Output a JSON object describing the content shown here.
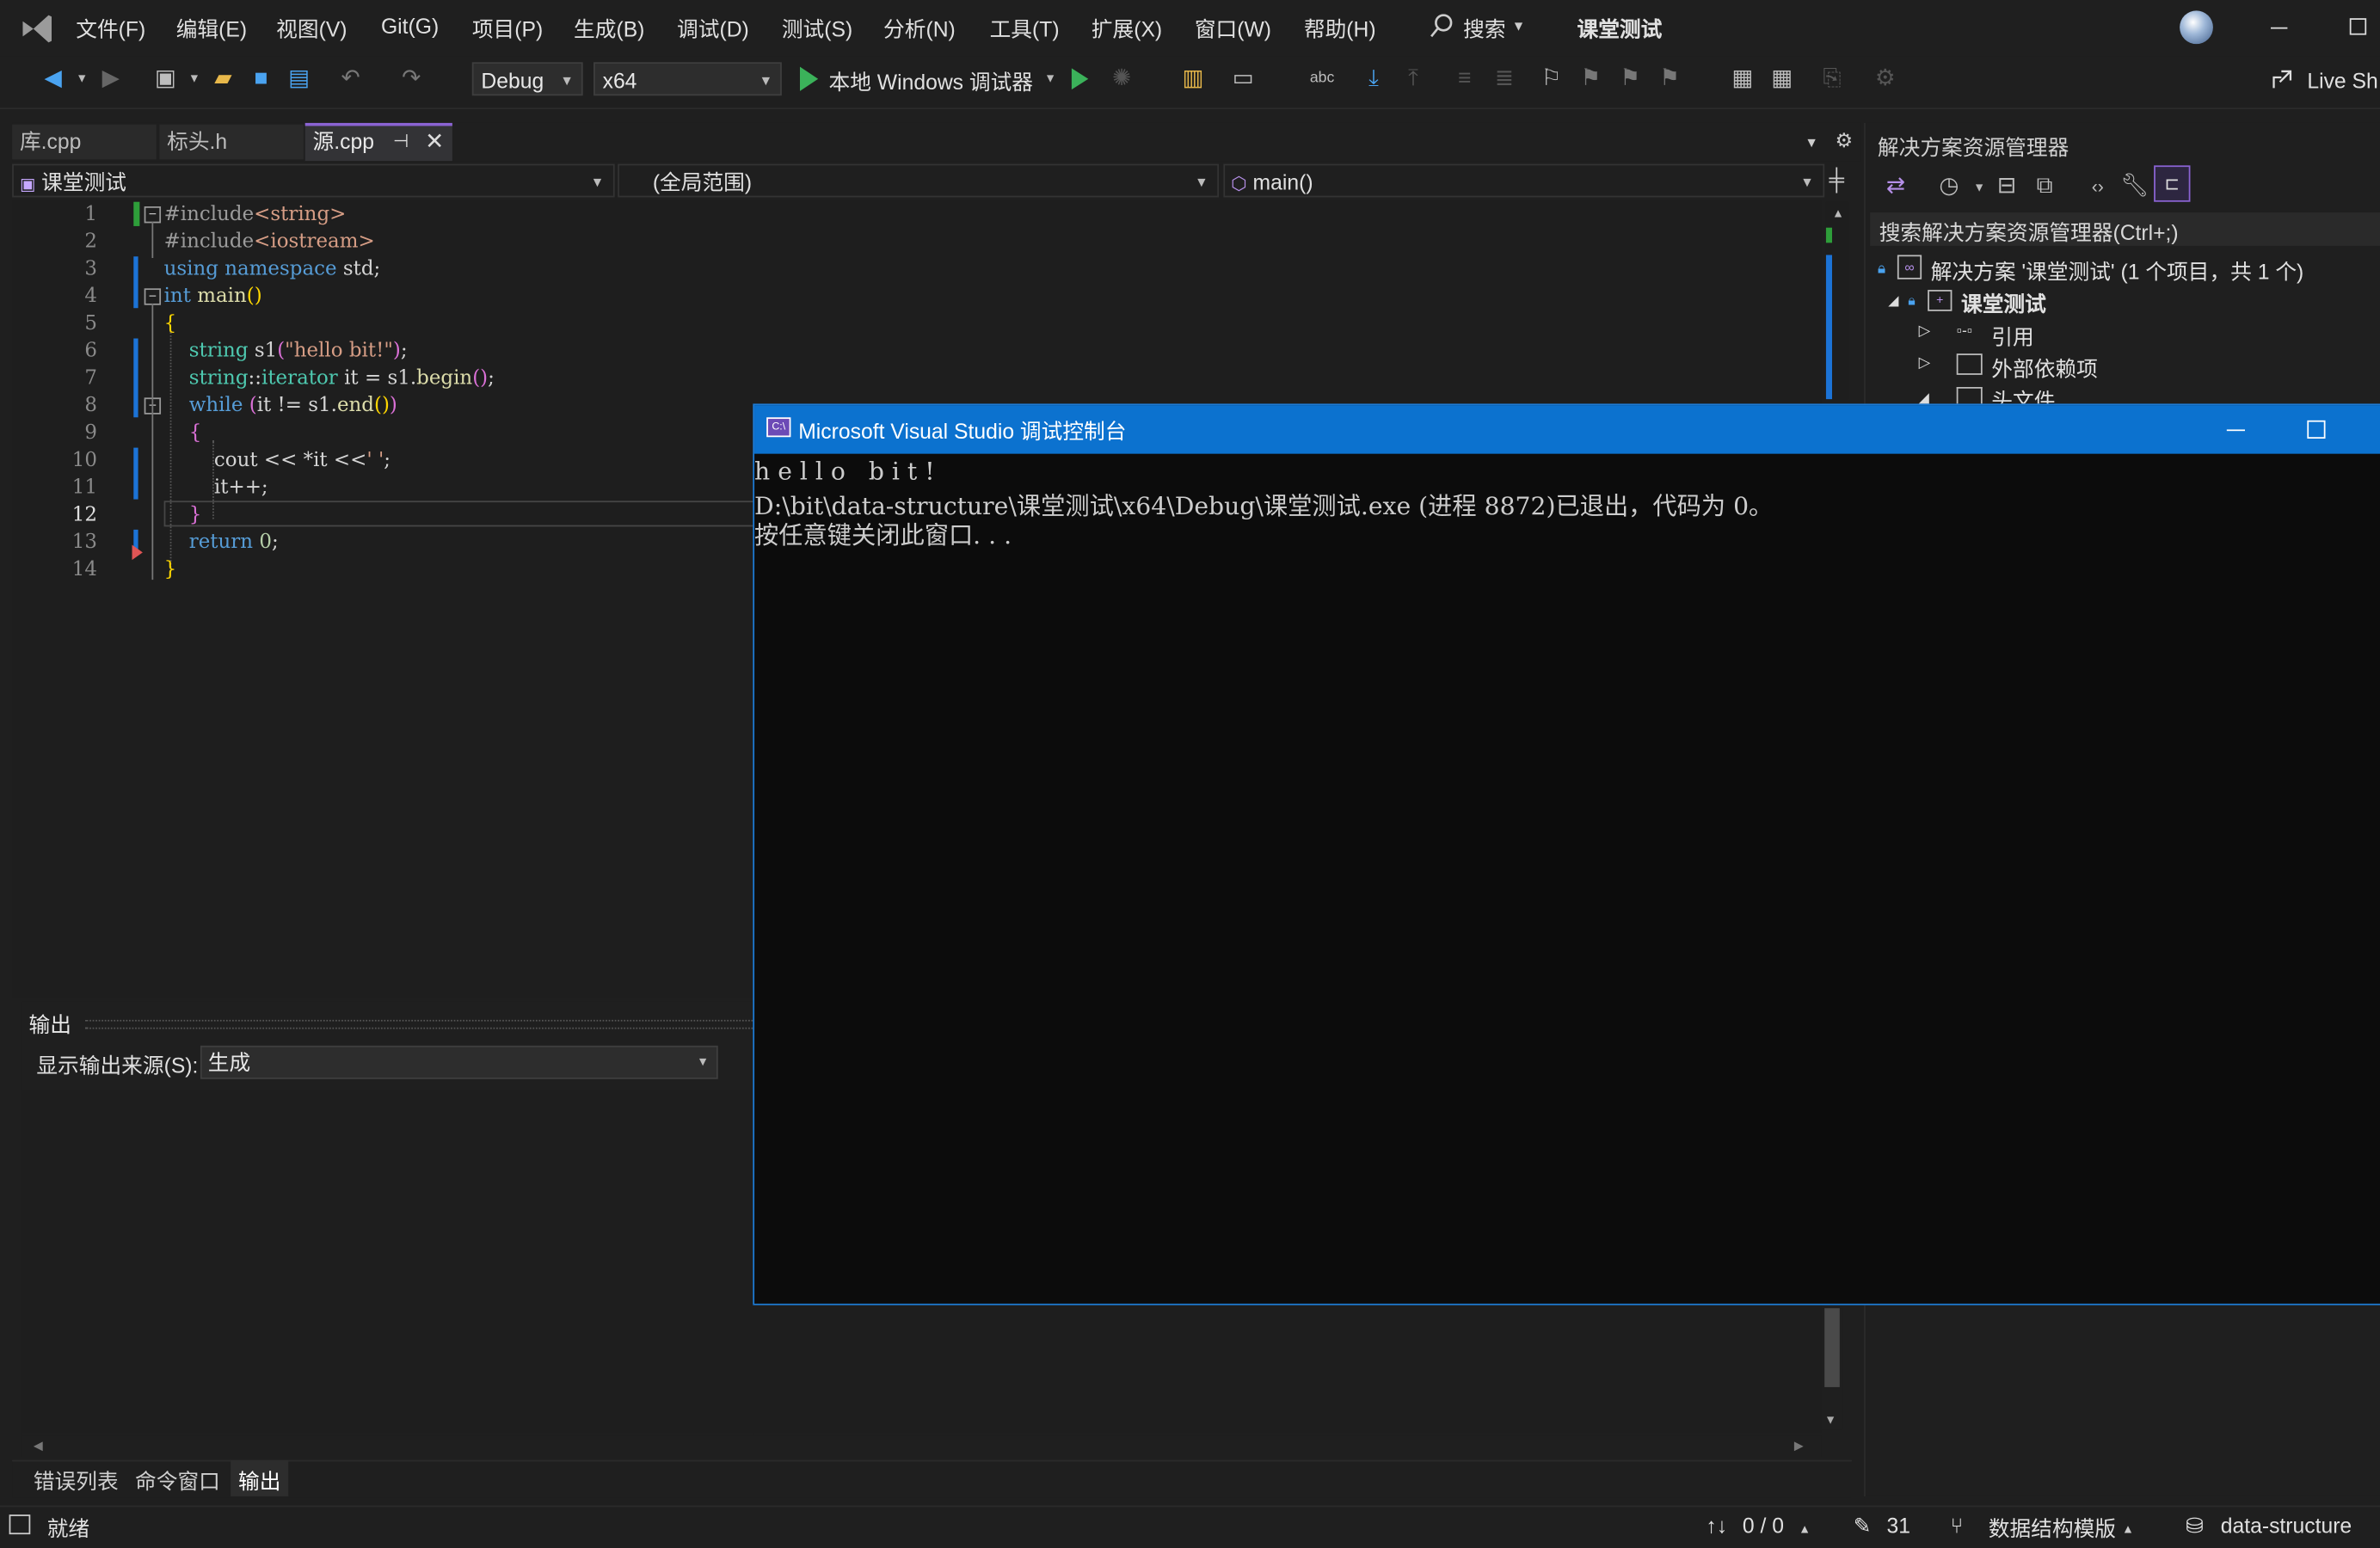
{
  "menubar": {
    "items": [
      "文件(F)",
      "编辑(E)",
      "视图(V)",
      "Git(G)",
      "项目(P)",
      "生成(B)",
      "调试(D)",
      "测试(S)",
      "分析(N)",
      "工具(T)",
      "扩展(X)",
      "窗口(W)",
      "帮助(H)"
    ],
    "search_label": "搜索",
    "solution_name": "课堂测试"
  },
  "toolbar": {
    "config": "Debug",
    "platform": "x64",
    "run_label": "本地 Windows 调试器",
    "live_share": "Live Sh"
  },
  "tabs": [
    {
      "label": "库.cpp"
    },
    {
      "label": "标头.h"
    },
    {
      "label": "源.cpp"
    }
  ],
  "navbar": {
    "project": "课堂测试",
    "scope": "(全局范围)",
    "member": "main()"
  },
  "editor": {
    "line_numbers": [
      "1",
      "2",
      "3",
      "4",
      "5",
      "6",
      "7",
      "8",
      "9",
      "10",
      "11",
      "12",
      "13",
      "14"
    ],
    "current_line": "12"
  },
  "console": {
    "title": "Microsoft Visual Studio 调试控制台",
    "lines": [
      "h e l l o   b i t !",
      "D:\\bit\\data-structure\\课堂测试\\x64\\Debug\\课堂测试.exe (进程 8872)已退出，代码为 0。",
      "按任意键关闭此窗口. . ."
    ]
  },
  "solution_explorer": {
    "title": "解决方案资源管理器",
    "search_placeholder": "搜索解决方案资源管理器(Ctrl+;)",
    "solution_label": "解决方案 '课堂测试' (1 个项目，共 1 个)",
    "project_label": "课堂测试",
    "references_label": "引用",
    "external_deps_label": "外部依赖项",
    "header_files_label": "头文件"
  },
  "output_panel": {
    "title": "输出",
    "source_label": "显示输出来源(S):",
    "source_value": "生成"
  },
  "bottom_tabs": [
    "错误列表",
    "命令窗口",
    "输出"
  ],
  "status": {
    "ready": "就绪",
    "changes": "0 / 0",
    "edits": "31",
    "branch": "数据结构模版",
    "repo": "data-structure"
  }
}
